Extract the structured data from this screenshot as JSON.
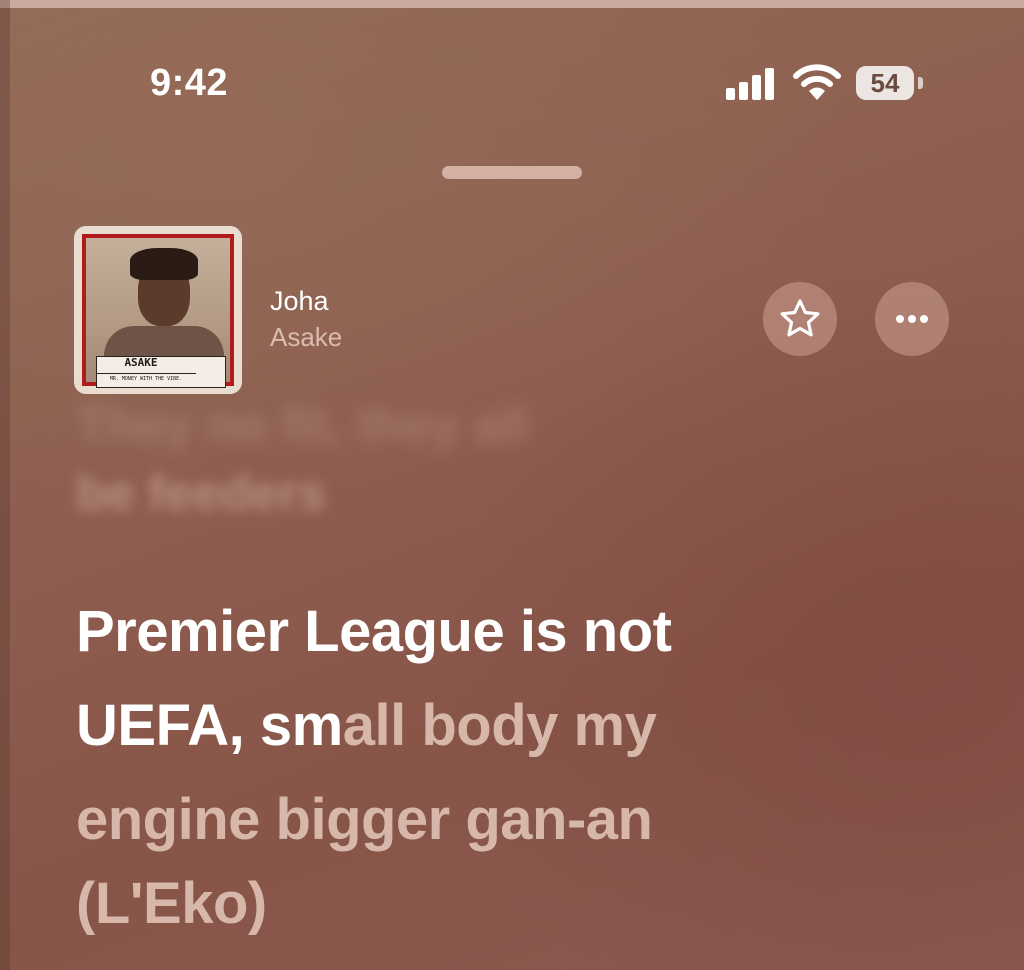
{
  "status_bar": {
    "time": "9:42",
    "battery": "54"
  },
  "now_playing": {
    "title": "Joha",
    "artist": "Asake",
    "artwork": {
      "name_plate": "ASAKE",
      "sub_plate": "MR. MONEY WITH THE VIBE."
    }
  },
  "actions": {
    "favorite_icon": "star-icon",
    "more_icon": "ellipsis-icon"
  },
  "lyrics": {
    "previous_line_1": "They no fit, they all",
    "previous_line_2": "be feeders",
    "current_line_1": "Premier League is not",
    "current_line_2_sung": "UEFA, sm",
    "current_line_2_unsung": "all body my",
    "current_line_3": "engine bigger gan-an",
    "current_line_4": "(L'Eko)"
  },
  "colors": {
    "background": "#8b5a4e",
    "sung_text": "#ffffff",
    "unsung_text": "#d7b7aa",
    "album_frame": "#b11b1b"
  }
}
